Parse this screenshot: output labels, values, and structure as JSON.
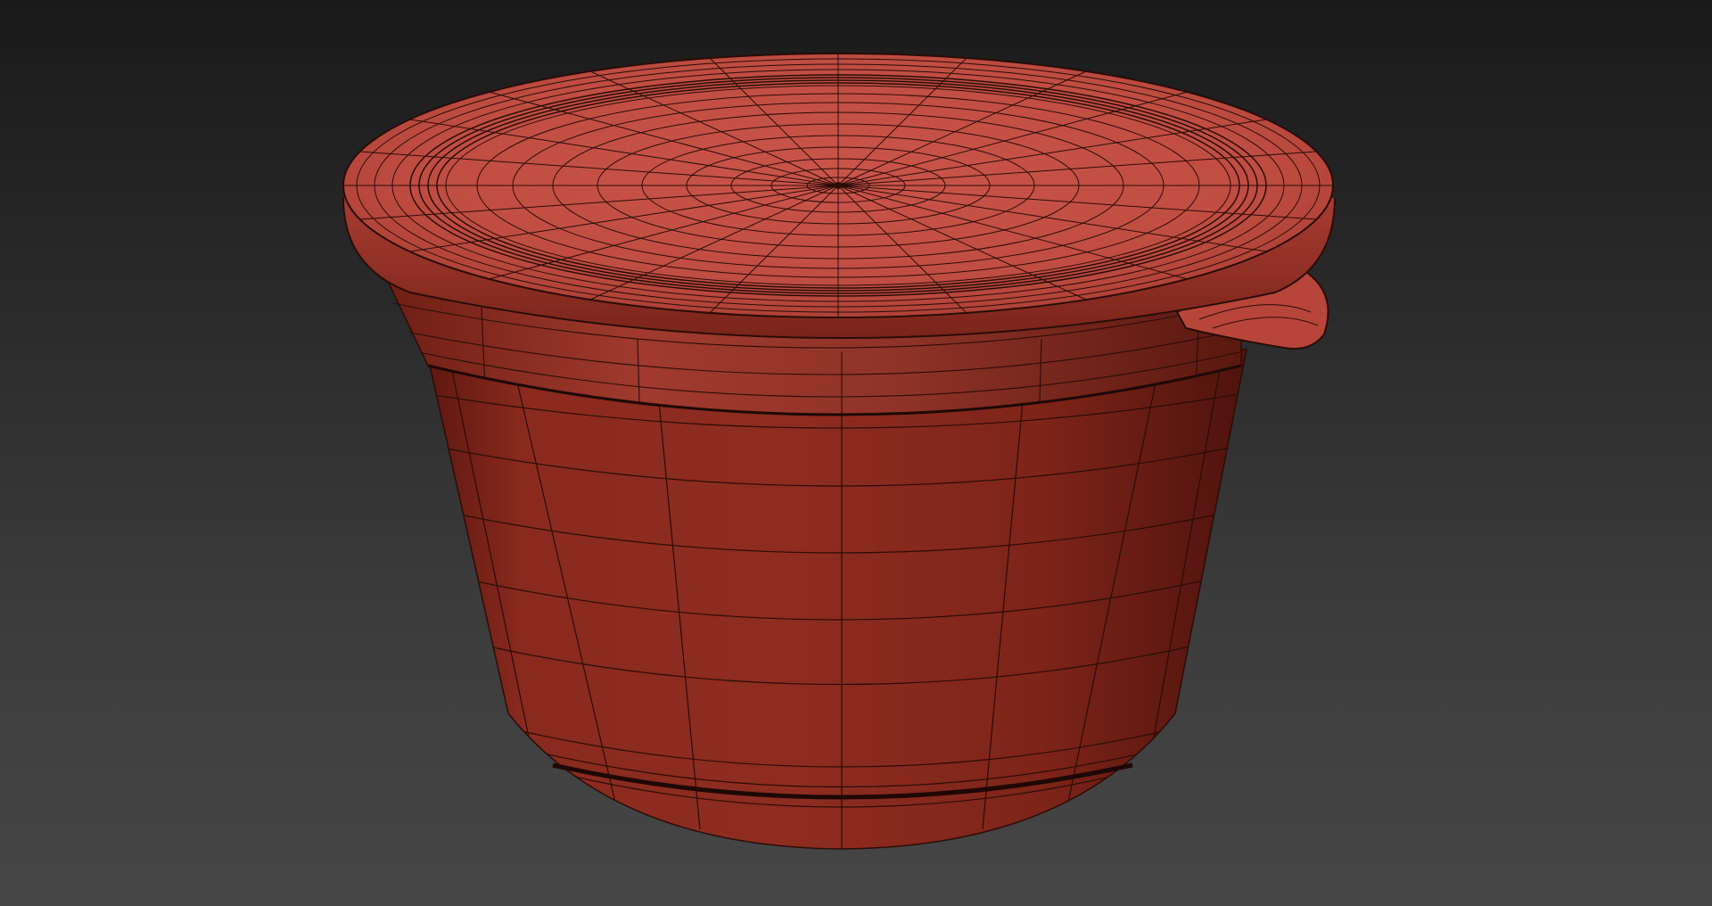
{
  "viewport": {
    "background_top": "#1a1a1a",
    "background_bottom": "#464646"
  },
  "model": {
    "object": "container-with-lid",
    "display_mode": "shaded-wireframe",
    "surface_color": "#b8453a",
    "body_color": "#8c2a1f",
    "wire_color": "#2a0c08"
  }
}
